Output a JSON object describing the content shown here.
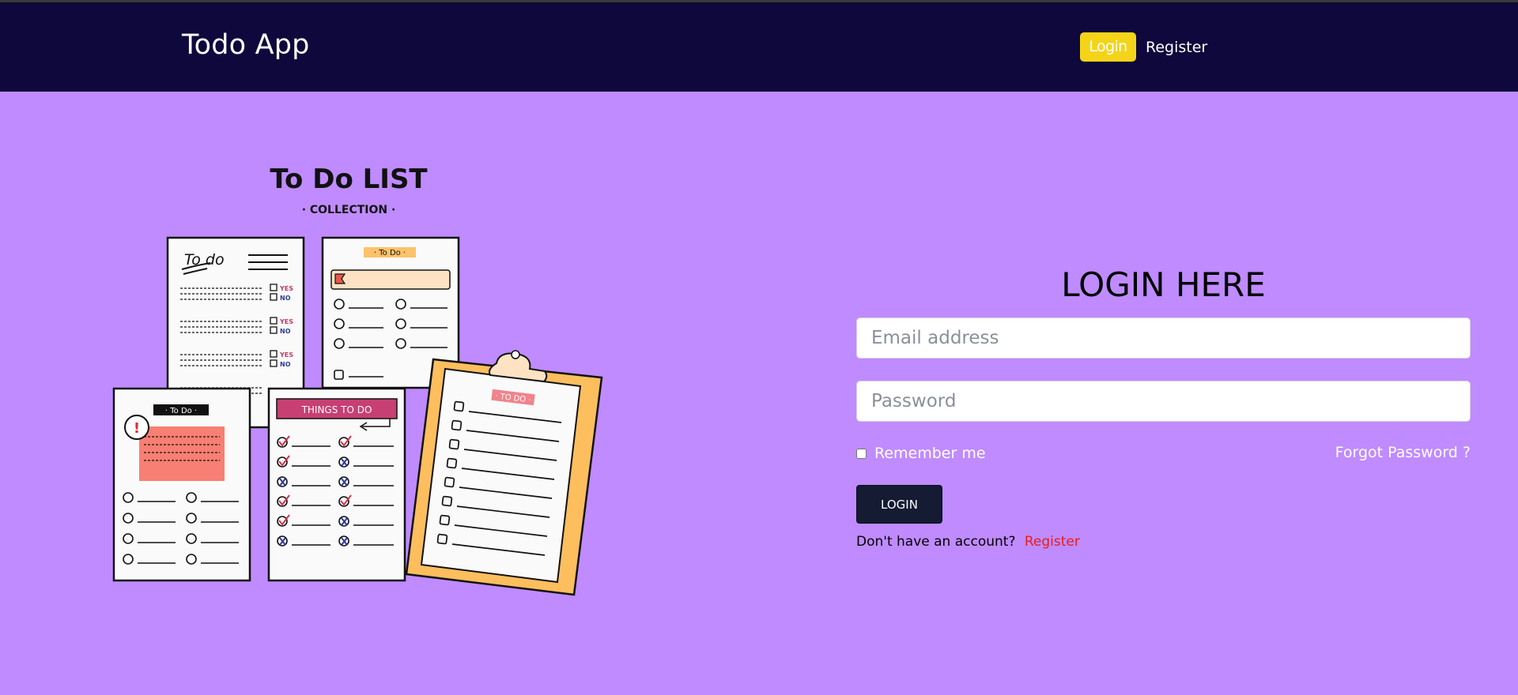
{
  "navbar": {
    "brand": "Todo App",
    "login_label": "Login",
    "register_label": "Register"
  },
  "illustration": {
    "title": "To Do LIST",
    "subtitle": "· COLLECTION ·",
    "note1_title": "To do",
    "yes": "YES",
    "no": "NO",
    "note2_tag": "· To Do ·",
    "note3_tag": "· To Do ·",
    "note4_banner": "THINGS TO DO",
    "clipboard_tag": "· TO DO ·"
  },
  "form": {
    "title": "LOGIN HERE",
    "email_placeholder": "Email address",
    "password_placeholder": "Password",
    "remember_label": "Remember me",
    "forgot_label": "Forgot Password ?",
    "submit_label": "LOGIN",
    "no_account_text": "Don't have an account?",
    "register_link": "Register"
  },
  "colors": {
    "navbar": "#0e083d",
    "background": "#bf8bff",
    "accent_yellow": "#f4d419",
    "button_dark": "#141b33",
    "link_red": "#e51d1d"
  }
}
